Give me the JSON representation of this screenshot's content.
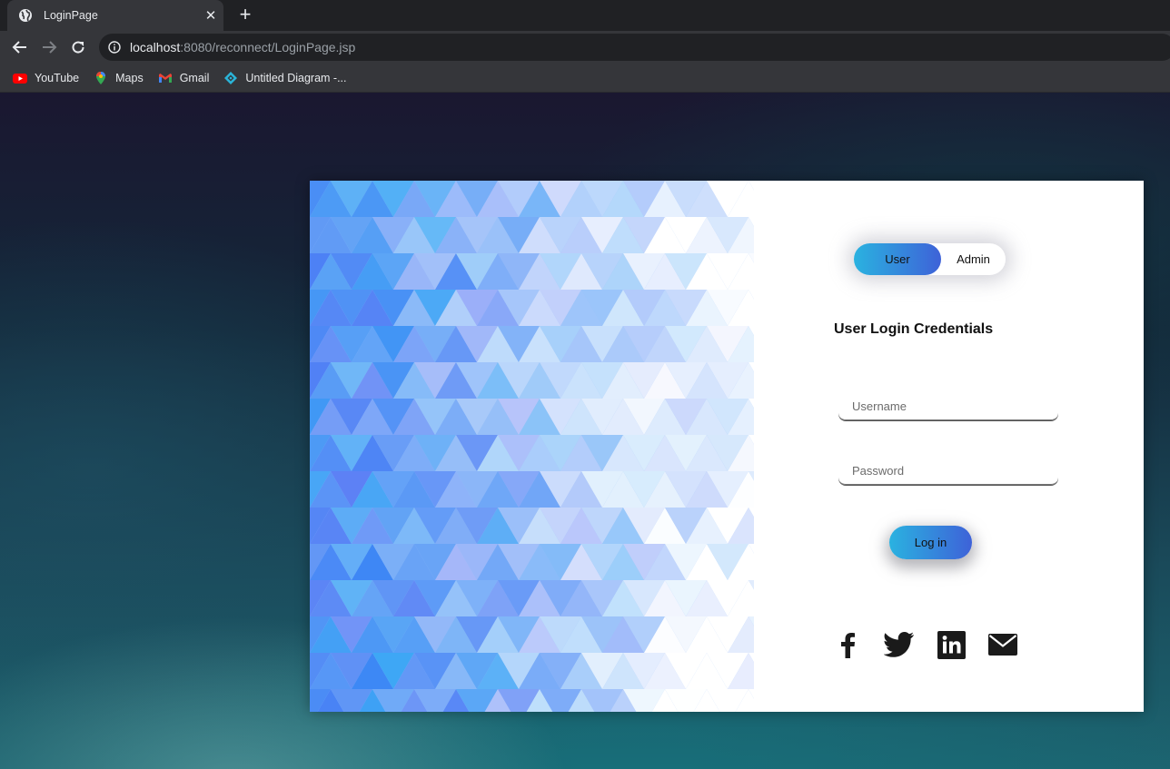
{
  "browser": {
    "tab": {
      "title": "LoginPage",
      "close_glyph": "✕",
      "icon": "globe-icon"
    },
    "new_tab_glyph": "+",
    "address": {
      "host": "localhost",
      "path": ":8080/reconnect/LoginPage.jsp"
    },
    "bookmarks": [
      {
        "label": "YouTube",
        "icon": "youtube-icon"
      },
      {
        "label": "Maps",
        "icon": "maps-pin-icon"
      },
      {
        "label": "Gmail",
        "icon": "gmail-icon"
      },
      {
        "label": "Untitled Diagram -...",
        "icon": "diagram-icon"
      }
    ]
  },
  "login": {
    "toggle": {
      "user_label": "User",
      "admin_label": "Admin",
      "selected": "User"
    },
    "title": "User Login Credentials",
    "username_placeholder": "Username",
    "password_placeholder": "Password",
    "login_button": "Log in",
    "socials": [
      "facebook-icon",
      "twitter-icon",
      "linkedin-icon",
      "email-icon"
    ]
  },
  "colors": {
    "accent_start": "#2ab2e0",
    "accent_end": "#3e62d8",
    "art_blue": "#3d7ff5"
  }
}
